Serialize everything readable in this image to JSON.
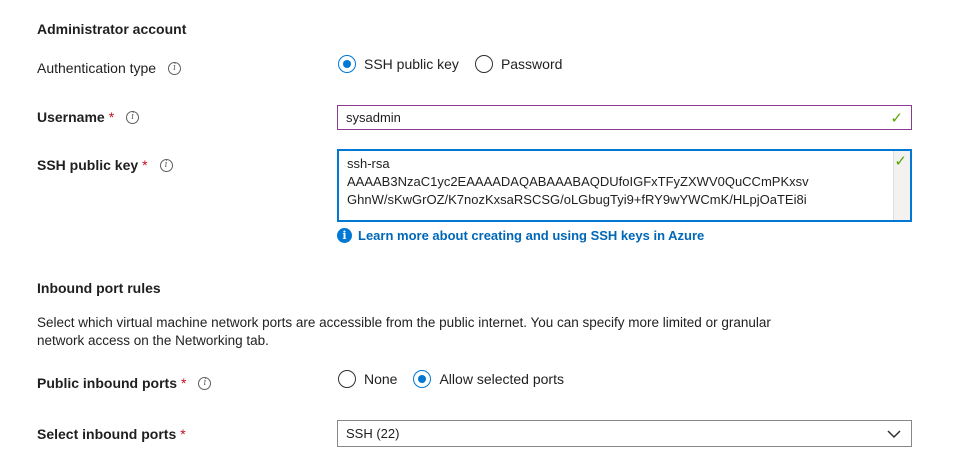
{
  "admin": {
    "title": "Administrator account",
    "auth_type_label": "Authentication type",
    "auth_options": [
      "SSH public key",
      "Password"
    ],
    "auth_selected": "SSH public key",
    "username_label": "Username",
    "username_value": "sysadmin",
    "ssh_key_label": "SSH public key",
    "ssh_key_lines": [
      "ssh-rsa",
      "AAAAB3NzaC1yc2EAAAADAQABAAABAQDUfoIGFxTFyZXWV0QuCCmPKxsv",
      "GhnW/sKwGrOZ/K7nozKxsaRSCSG/oLGbugTyi9+fRY9wYWCmK/HLpjOaTEi8i"
    ],
    "ssh_learn_more": "Learn more about creating and using SSH keys in Azure"
  },
  "inbound": {
    "title": "Inbound port rules",
    "description_line1": "Select which virtual machine network ports are accessible from the public internet. You can specify more limited or granular",
    "description_line2": "network access on the Networking tab.",
    "public_ports_label": "Public inbound ports",
    "public_ports_options": [
      "None",
      "Allow selected ports"
    ],
    "public_ports_selected": "Allow selected ports",
    "select_ports_label": "Select inbound ports",
    "select_ports_value": "SSH (22)"
  },
  "required_marker": "*",
  "icons": {
    "info": "info-icon",
    "check": "checkmark-icon",
    "chevron": "chevron-down-icon",
    "link_info": "info-filled-icon"
  },
  "colors": {
    "accent": "#0078d4",
    "required": "#c50f1f",
    "valid": "#57a300",
    "link": "#0067b8"
  }
}
